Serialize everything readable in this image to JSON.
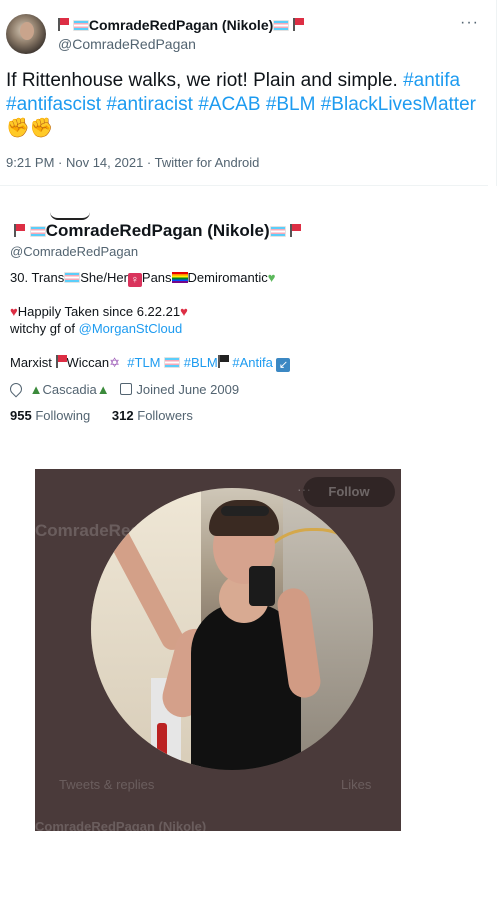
{
  "tweet": {
    "author_name": "ComradeRedPagan (Nikole)",
    "author_handle": "@ComradeRedPagan",
    "more_label": "···",
    "text_plain": "If Rittenhouse walks, we riot! Plain and simple.",
    "hashtags": [
      "#antifa",
      "#antifascist",
      "#antiracist",
      "#ACAB",
      "#BLM",
      "#BlackLivesMatter"
    ],
    "timestamp": "9:21 PM · Nov 14, 2021 · Twitter for Android"
  },
  "profile": {
    "name": "ComradeRedPagan (Nikole)",
    "handle": "@ComradeRedPagan",
    "bio_age": "30. Trans",
    "bio_pronouns": "She/Her",
    "bio_pans": "Pans",
    "bio_demi": "Demiromantic",
    "bio_taken": "Happily Taken since 6.22.21",
    "bio_gf_prefix": "witchy gf of",
    "bio_gf_link": "@MorganStCloud",
    "bio_marxist": "Marxist",
    "bio_wiccan": "Wiccan",
    "bio_tag_tlm": "#TLM",
    "bio_tag_blm": "#BLM",
    "bio_tag_antifa": "#Antifa",
    "location": "Cascadia",
    "joined": "Joined June 2009",
    "following_count": "955",
    "following_label": "Following",
    "followers_count": "312",
    "followers_label": "Followers"
  },
  "photo_overlay": {
    "name": "ComradeRedPagan",
    "follow_label": "Follow",
    "tabs_label": "Tweets & replies",
    "likes_label": "Likes",
    "footer": "ComradeRedPagan (Nikole)",
    "more_label": "···"
  },
  "colors": {
    "link": "#1d9bf0",
    "text": "#0f1419",
    "muted": "#536471",
    "photo_bg": "#4a3a3a"
  },
  "icons": [
    "red-flag-icon",
    "trans-flag-icon",
    "female-sign-icon",
    "rainbow-flag-icon",
    "green-heart-icon",
    "red-heart-icon",
    "wiccan-icon",
    "black-flag-icon",
    "arrow-icon",
    "location-icon",
    "tree-icon",
    "calendar-icon",
    "fist-icon"
  ]
}
